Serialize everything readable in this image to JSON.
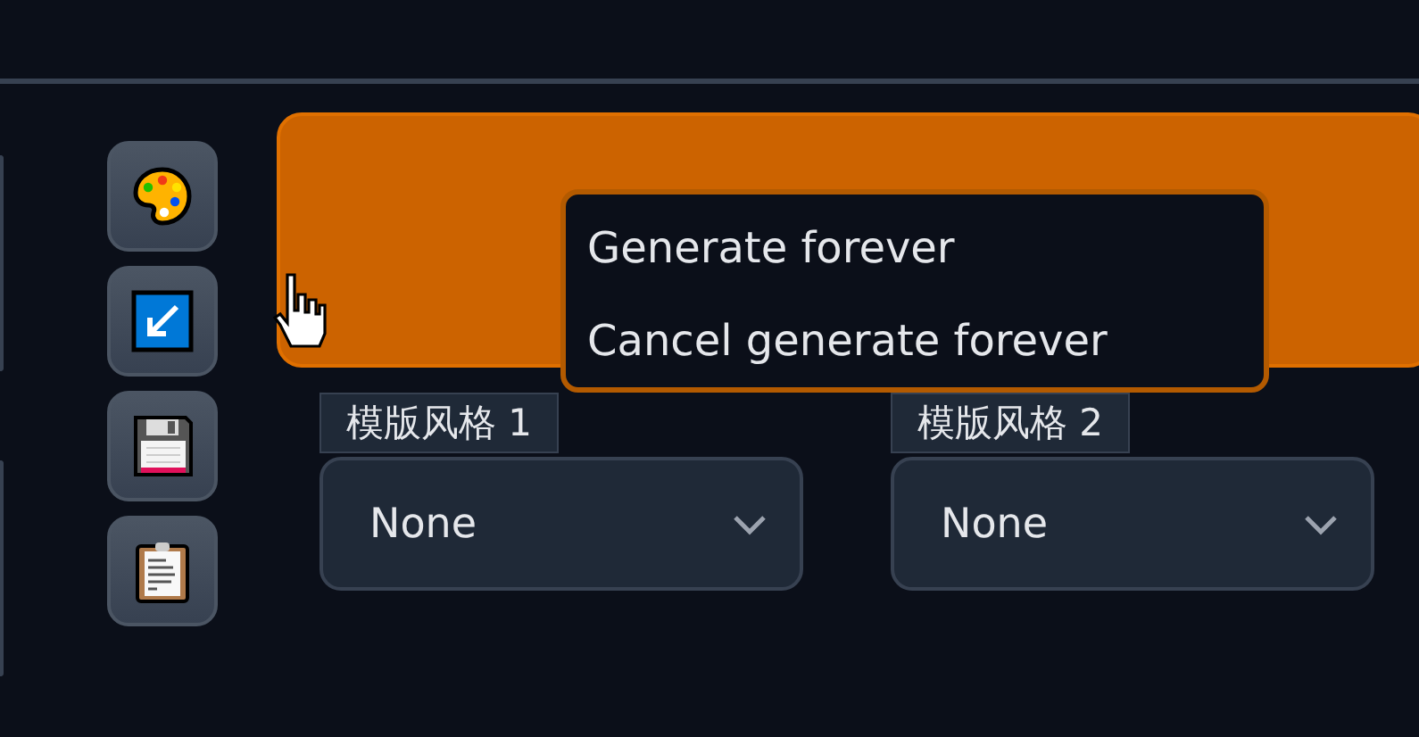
{
  "tool_buttons": [
    {
      "kind": "palette"
    },
    {
      "kind": "arrow"
    },
    {
      "kind": "save"
    },
    {
      "kind": "clipboard"
    }
  ],
  "context_menu": {
    "items": [
      "Generate forever",
      "Cancel generate forever"
    ]
  },
  "style_selects": [
    {
      "label": "模版风格 1",
      "value": "None"
    },
    {
      "label": "模版风格 2",
      "value": "None"
    }
  ]
}
